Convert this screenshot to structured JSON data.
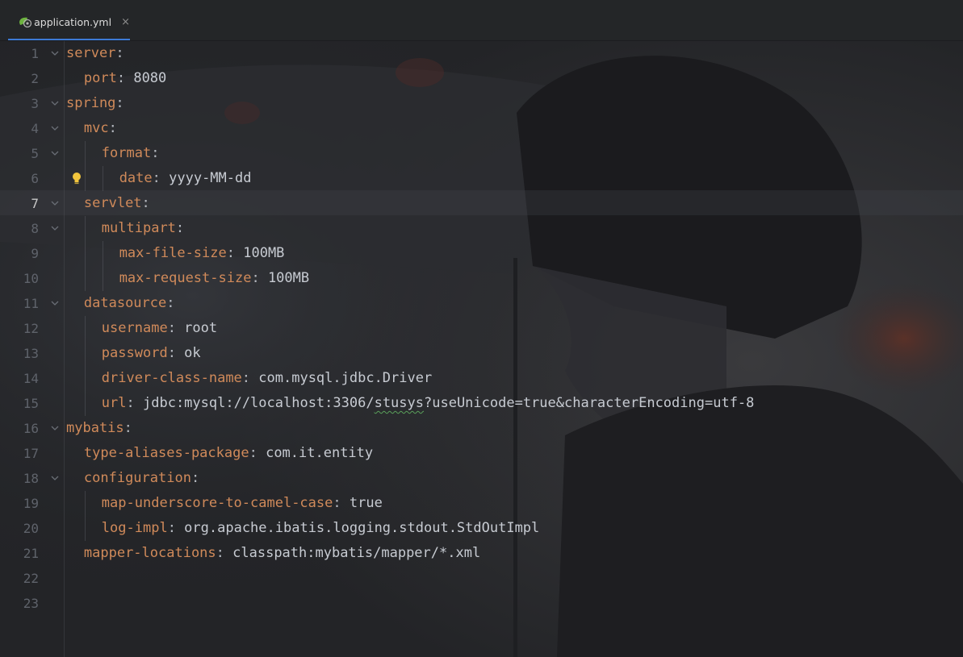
{
  "tab": {
    "label": "application.yml",
    "close_glyph": "×",
    "icon": "spring-yaml-file-icon"
  },
  "colors": {
    "key": "#d08a5a",
    "value": "#c7cbd2",
    "line_number": "#5f636b",
    "tab_underline": "#3d7bd6"
  },
  "editor": {
    "current_line": 7,
    "lines": [
      {
        "n": "1",
        "key": "server",
        "sep": ":",
        "value": ""
      },
      {
        "n": "2",
        "key": "port",
        "sep": ": ",
        "value": "8080"
      },
      {
        "n": "3",
        "key": "spring",
        "sep": ":",
        "value": ""
      },
      {
        "n": "4",
        "key": "mvc",
        "sep": ":",
        "value": ""
      },
      {
        "n": "5",
        "key": "format",
        "sep": ":",
        "value": ""
      },
      {
        "n": "6",
        "key": "date",
        "sep": ": ",
        "value": "yyyy-MM-dd"
      },
      {
        "n": "7",
        "key": "servlet",
        "sep": ":",
        "value": ""
      },
      {
        "n": "8",
        "key": "multipart",
        "sep": ":",
        "value": ""
      },
      {
        "n": "9",
        "key": "max-file-size",
        "sep": ": ",
        "value": "100MB"
      },
      {
        "n": "10",
        "key": "max-request-size",
        "sep": ": ",
        "value": "100MB"
      },
      {
        "n": "11",
        "key": "datasource",
        "sep": ":",
        "value": ""
      },
      {
        "n": "12",
        "key": "username",
        "sep": ": ",
        "value": "root"
      },
      {
        "n": "13",
        "key": "password",
        "sep": ": ",
        "value": "ok"
      },
      {
        "n": "14",
        "key": "driver-class-name",
        "sep": ": ",
        "value": "com.mysql.jdbc.Driver"
      },
      {
        "n": "15",
        "key": "url",
        "sep": ": ",
        "value_pre": "jdbc:mysql://localhost:3306/",
        "value_squiggle": "stusys",
        "value_post": "?useUnicode=true&characterEncoding=utf-8"
      },
      {
        "n": "16",
        "key": "mybatis",
        "sep": ":",
        "value": ""
      },
      {
        "n": "17",
        "key": "type-aliases-package",
        "sep": ": ",
        "value": "com.it.entity"
      },
      {
        "n": "18",
        "key": "configuration",
        "sep": ":",
        "value": ""
      },
      {
        "n": "19",
        "key": "map-underscore-to-camel-case",
        "sep": ": ",
        "value": "true"
      },
      {
        "n": "20",
        "key": "log-impl",
        "sep": ": ",
        "value": "org.apache.ibatis.logging.stdout.StdOutImpl"
      },
      {
        "n": "21",
        "key": "mapper-locations",
        "sep": ": ",
        "value": "classpath:mybatis/mapper/*.xml"
      },
      {
        "n": "22",
        "key": "",
        "sep": "",
        "value": ""
      },
      {
        "n": "23",
        "key": "",
        "sep": "",
        "value": ""
      }
    ]
  }
}
